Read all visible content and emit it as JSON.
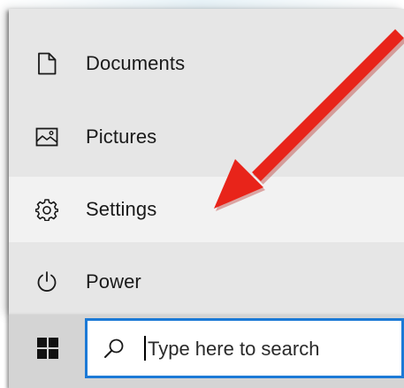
{
  "start_menu": {
    "items": [
      {
        "label": "Documents",
        "icon": "document-icon"
      },
      {
        "label": "Pictures",
        "icon": "pictures-icon"
      },
      {
        "label": "Settings",
        "icon": "gear-icon",
        "highlighted": true
      },
      {
        "label": "Power",
        "icon": "power-icon"
      }
    ]
  },
  "taskbar": {
    "start_button_icon": "windows-logo-icon",
    "search": {
      "placeholder": "Type here to search",
      "icon": "search-icon"
    }
  },
  "annotation": {
    "type": "arrow",
    "color": "#e8241a",
    "points_to": "Settings"
  },
  "colors": {
    "panel_bg": "#e6e6e6",
    "highlight_bg": "#f2f2f2",
    "taskbar_bg": "#d4d4d4",
    "search_border": "#1c7ad6",
    "arrow": "#e8241a"
  }
}
